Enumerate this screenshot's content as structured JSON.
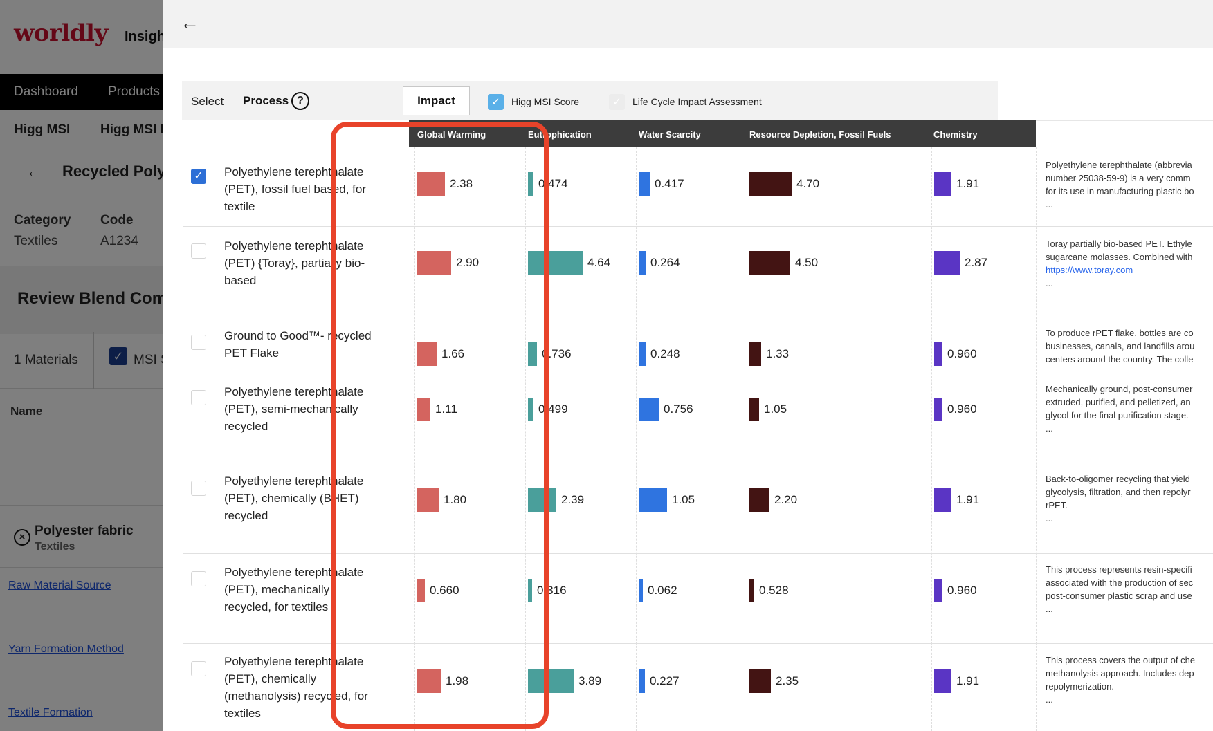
{
  "background": {
    "logo": "worldly",
    "app_name": "Insights",
    "nav": [
      "Dashboard",
      "Products"
    ],
    "subnav": [
      "Higg MSI",
      "Higg MSI D"
    ],
    "product_title": "Recycled Polye",
    "category_label": "Category",
    "category_value": "Textiles",
    "code_label": "Code",
    "code_value": "A1234",
    "review_title": "Review Blend Comp",
    "materials_count": "1 Materials",
    "msi_label": "MSI S",
    "name_header": "Name",
    "fabric_name": "Polyester fabric",
    "fabric_category": "Textiles",
    "links": [
      "Raw Material Source",
      "Yarn Formation Method",
      "Textile Formation"
    ]
  },
  "drawer": {
    "back_icon": "arrow-left-icon",
    "controls": {
      "select_label": "Select",
      "process_label": "Process",
      "help_glyph": "?",
      "impact_button": "Impact",
      "msi_checkbox_label": "Higg MSI Score",
      "msi_checked": true,
      "lca_checkbox_label": "Life Cycle Impact Assessment",
      "lca_checked": false
    },
    "columns": [
      "Global Warming",
      "Eutrophication",
      "Water Scarcity",
      "Resource Depletion, Fossil Fuels",
      "Chemistry"
    ],
    "colors": {
      "global_warming": "#d4645f",
      "eutrophication": "#4a9f9b",
      "water_scarcity": "#2f74e0",
      "resource_depletion": "#431413",
      "chemistry": "#5a35c4",
      "callout": "#e8432a"
    },
    "rows": [
      {
        "checked": true,
        "name": "Polyethylene terephthalate (PET), fossil fuel based, for textile",
        "values": [
          "2.38",
          "0.474",
          "0.417",
          "4.70",
          "1.91"
        ],
        "description": [
          "Polyethylene terephthalate (abbrevia",
          "number 25038-59-9) is a very comm",
          "for its use in manufacturing plastic bo",
          "..."
        ]
      },
      {
        "checked": false,
        "name": "Polyethylene terephthalate (PET) {Toray}, partially bio-based",
        "values": [
          "2.90",
          "4.64",
          "0.264",
          "4.50",
          "2.87"
        ],
        "description": [
          "Toray partially bio-based PET. Ethyle",
          "sugarcane molasses. Combined with",
          "https://www.toray.com",
          "..."
        ]
      },
      {
        "checked": false,
        "name": "Ground to Good™- recycled PET Flake",
        "values": [
          "1.66",
          "0.736",
          "0.248",
          "1.33",
          "0.960"
        ],
        "description": [
          "To produce rPET flake, bottles are co",
          "businesses, canals, and landfills arou",
          "centers around the country. The colle"
        ]
      },
      {
        "checked": false,
        "name": "Polyethylene terephthalate (PET), semi-mechanically recycled",
        "values": [
          "1.11",
          "0.499",
          "0.756",
          "1.05",
          "0.960"
        ],
        "description": [
          "Mechanically ground, post-consumer",
          "extruded, purified, and pelletized, an",
          "glycol for the final purification stage.",
          "..."
        ]
      },
      {
        "checked": false,
        "name": "Polyethylene terephthalate (PET), chemically (BHET) recycled",
        "values": [
          "1.80",
          "2.39",
          "1.05",
          "2.20",
          "1.91"
        ],
        "description": [
          "Back-to-oligomer recycling that yield",
          "glycolysis, filtration, and then repolyr",
          "rPET.",
          "..."
        ]
      },
      {
        "checked": false,
        "name": "Polyethylene terephthalate (PET), mechanically recycled, for textiles",
        "values": [
          "0.660",
          "0.316",
          "0.062",
          "0.528",
          "0.960"
        ],
        "description": [
          "This process represents resin-specifi",
          "associated with the production of sec",
          "post-consumer plastic scrap and use",
          "..."
        ]
      },
      {
        "checked": false,
        "name": "Polyethylene terephthalate (PET), chemically (methanolysis) recycled, for textiles",
        "values": [
          "1.98",
          "3.89",
          "0.227",
          "2.35",
          "1.91"
        ],
        "description": [
          "This process covers the output of che",
          "methanolysis approach. Includes dep",
          "repolymerization.",
          "..."
        ]
      }
    ]
  }
}
